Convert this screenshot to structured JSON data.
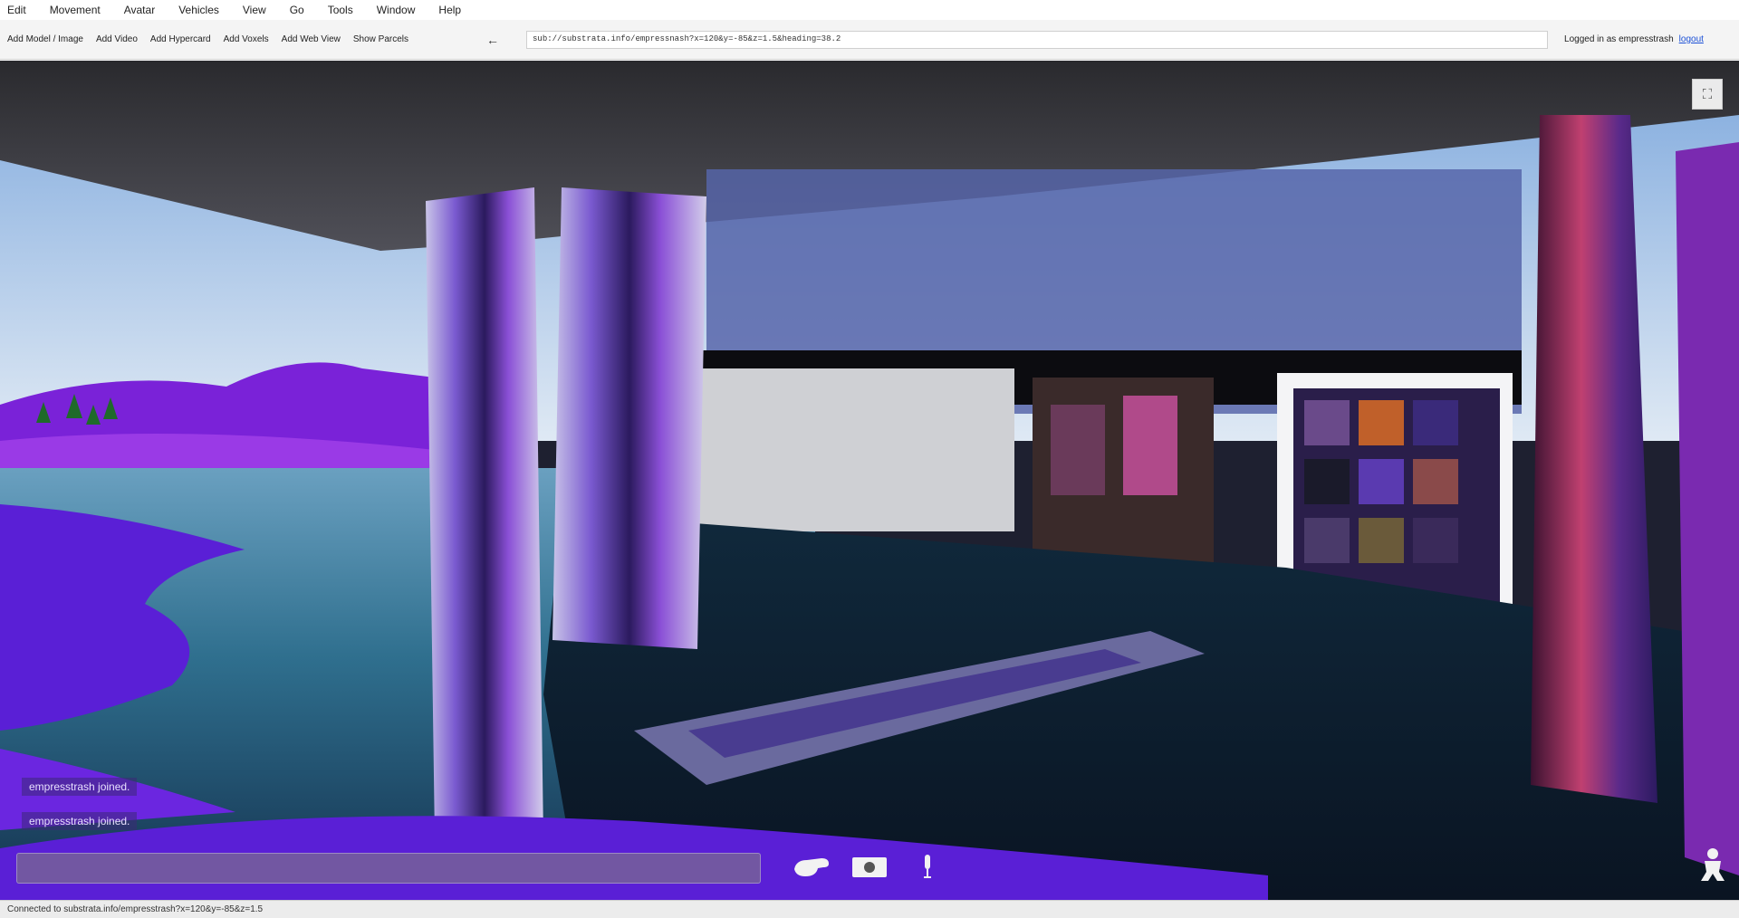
{
  "menu": {
    "items": [
      "Edit",
      "Movement",
      "Avatar",
      "Vehicles",
      "View",
      "Go",
      "Tools",
      "Window",
      "Help"
    ]
  },
  "toolbar": {
    "buttons": [
      "Add Model / Image",
      "Add Video",
      "Add Hypercard",
      "Add Voxels",
      "Add Web View",
      "Show Parcels"
    ],
    "back_icon": "back-arrow-icon",
    "url": "sub://substrata.info/empressnash?x=120&y=-85&z=1.5&heading=38.2",
    "login_status": "Logged in as empresstrash",
    "logout_label": "logout"
  },
  "chat": {
    "messages": [
      "empresstrash joined.",
      "empresstrash joined."
    ],
    "input_value": ""
  },
  "hud": {
    "gesture_icon": "gesture-icon",
    "camera_icon": "camera-icon",
    "mic_icon": "microphone-icon",
    "avatar_icon": "avatar-icon",
    "fullscreen_icon": "fullscreen-icon"
  },
  "status": {
    "text": "Connected to substrata.info/empresstrash?x=120&y=-85&z=1.5"
  },
  "colors": {
    "ground": "#5a1fd6",
    "water": "#2b6a8a",
    "sky_top": "#8fb8e6",
    "sky_bottom": "#d8e6f4"
  }
}
